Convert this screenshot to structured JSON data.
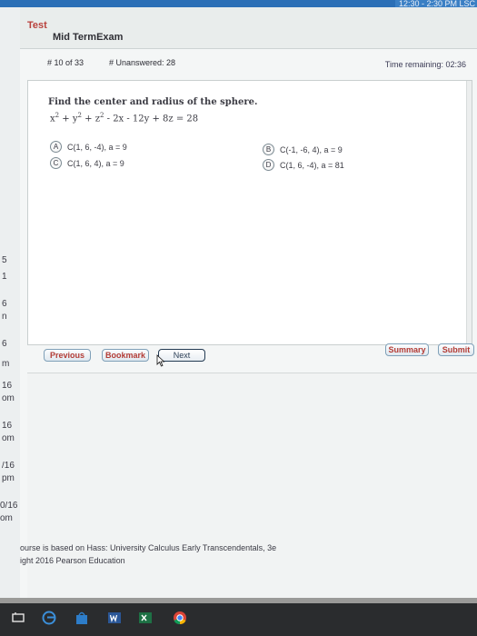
{
  "top_bar": {
    "clock_fragment": "12:30 - 2:30 PM LSC"
  },
  "side_strip_labels": [
    "5",
    "1",
    "6",
    "n",
    "6",
    "m",
    "16",
    "om",
    "16",
    "om",
    "/16",
    "pm",
    "0/16",
    "om"
  ],
  "exam": {
    "app_label": "Test",
    "title": "Mid TermExam",
    "question_counter": "# 10 of 33",
    "unanswered": "# Unanswered: 28",
    "time_remaining": "Time remaining: 02:36"
  },
  "question": {
    "prompt": "Find the center and radius of the sphere.",
    "equation_parts": [
      "x",
      "2",
      " + y",
      "2",
      " + z",
      "2",
      " - 2x - 12y + 8z = 28"
    ],
    "choices": [
      {
        "letter": "A",
        "text": "C(1, 6, -4), a = 9"
      },
      {
        "letter": "B",
        "text": "C(-1, -6, 4), a = 9"
      },
      {
        "letter": "C",
        "text": "C(1, 6, 4), a = 9"
      },
      {
        "letter": "D",
        "text": "C(1, 6, -4), a = 81"
      }
    ]
  },
  "nav": {
    "previous": "Previous",
    "bookmark": "Bookmark",
    "next": "Next",
    "summary": "Summary",
    "submit": "Submit"
  },
  "footer": {
    "line1": "ourse is based on Hass: University Calculus Early Transcendentals, 3e",
    "line2": "ight 2016 Pearson Education"
  },
  "taskbar": {
    "icons": [
      "task-view-icon",
      "edge-icon",
      "store-icon",
      "word-icon",
      "excel-icon",
      "chrome-icon"
    ]
  },
  "colors": {
    "accent_red": "#b33c36",
    "taskbar": "#2a2c2e",
    "topbar_blue": "#2b6fb6"
  }
}
